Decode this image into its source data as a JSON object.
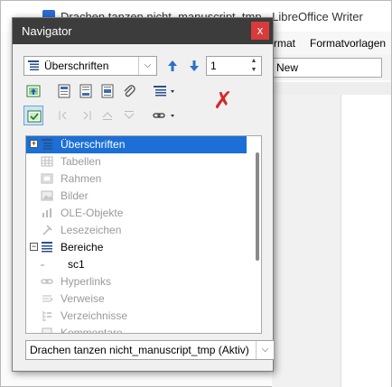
{
  "writer": {
    "title": "Drachen tanzen nicht_manuscript_tmp - LibreOffice Writer",
    "menu": [
      "rmat",
      "Formatvorlagen"
    ],
    "paragraph_style": "New"
  },
  "navigator": {
    "title": "Navigator",
    "close_label": "x",
    "category_select": "Überschriften",
    "page_number": "1",
    "tree": [
      {
        "label": "Überschriften",
        "expander": "+",
        "icon": "headings-icon",
        "selected": true,
        "dim": false
      },
      {
        "label": "Tabellen",
        "expander": "",
        "icon": "table-icon",
        "selected": false,
        "dim": true
      },
      {
        "label": "Rahmen",
        "expander": "",
        "icon": "frame-icon",
        "selected": false,
        "dim": true
      },
      {
        "label": "Bilder",
        "expander": "",
        "icon": "image-icon",
        "selected": false,
        "dim": true
      },
      {
        "label": "OLE-Objekte",
        "expander": "",
        "icon": "ole-object-icon",
        "selected": false,
        "dim": true
      },
      {
        "label": "Lesezeichen",
        "expander": "",
        "icon": "bookmark-icon",
        "selected": false,
        "dim": true
      },
      {
        "label": "Bereiche",
        "expander": "−",
        "icon": "sections-icon",
        "selected": false,
        "dim": false
      },
      {
        "label": "sc1",
        "expander": "",
        "icon": "",
        "selected": false,
        "dim": false
      },
      {
        "label": "Hyperlinks",
        "expander": "",
        "icon": "hyperlink-icon",
        "selected": false,
        "dim": true
      },
      {
        "label": "Verweise",
        "expander": "",
        "icon": "reference-icon",
        "selected": false,
        "dim": true
      },
      {
        "label": "Verzeichnisse",
        "expander": "",
        "icon": "index-icon",
        "selected": false,
        "dim": true
      },
      {
        "label": "Kommentare",
        "expander": "",
        "icon": "comment-icon",
        "selected": false,
        "dim": true
      }
    ],
    "document_select": "Drachen tanzen nicht_manuscript_tmp (Aktiv)"
  },
  "colors": {
    "selection": "#1b6fd6",
    "close_button": "#d83b3b",
    "titlebar": "#3c3c3c",
    "annotation_x": "#d62828"
  }
}
